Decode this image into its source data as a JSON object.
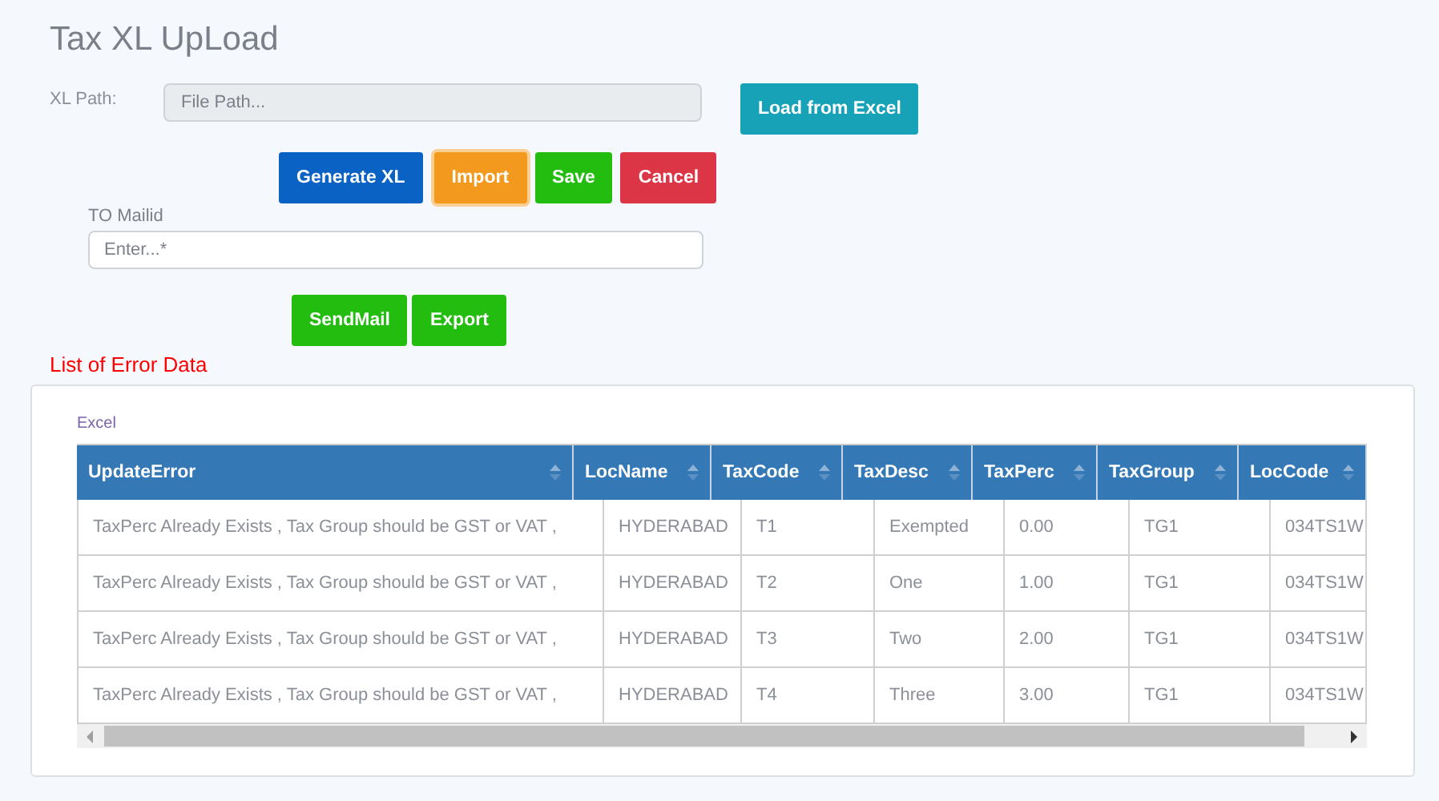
{
  "title": "Tax XL UpLoad",
  "xl_path": {
    "label": "XL Path:",
    "placeholder": "File Path..."
  },
  "load_button": "Load from Excel",
  "action_buttons": [
    {
      "label": "Generate XL",
      "kind": "primary",
      "focused": false
    },
    {
      "label": "Import",
      "kind": "warning",
      "focused": true
    },
    {
      "label": "Save",
      "kind": "success",
      "focused": false
    },
    {
      "label": "Cancel",
      "kind": "danger",
      "focused": false
    }
  ],
  "mail": {
    "label": "TO Mailid",
    "placeholder": "Enter...*"
  },
  "mail_buttons": [
    {
      "label": "SendMail",
      "kind": "success"
    },
    {
      "label": "Export",
      "kind": "success"
    }
  ],
  "error_heading": "List of Error Data",
  "panel": {
    "caption": "Excel",
    "table": {
      "columns": [
        "UpdateError",
        "LocName",
        "TaxCode",
        "TaxDesc",
        "TaxPerc",
        "TaxGroup",
        "LocCode"
      ],
      "rows": [
        [
          "TaxPerc Already Exists , Tax Group should be GST or VAT ,",
          "HYDERABAD",
          "T1",
          "Exempted",
          "0.00",
          "TG1",
          "034TS1W"
        ],
        [
          "TaxPerc Already Exists , Tax Group should be GST or VAT ,",
          "HYDERABAD",
          "T2",
          "One",
          "1.00",
          "TG1",
          "034TS1W"
        ],
        [
          "TaxPerc Already Exists , Tax Group should be GST or VAT ,",
          "HYDERABAD",
          "T3",
          "Two",
          "2.00",
          "TG1",
          "034TS1W"
        ],
        [
          "TaxPerc Already Exists , Tax Group should be GST or VAT ,",
          "HYDERABAD",
          "T4",
          "Three",
          "3.00",
          "TG1",
          "034TS1W"
        ]
      ]
    }
  }
}
